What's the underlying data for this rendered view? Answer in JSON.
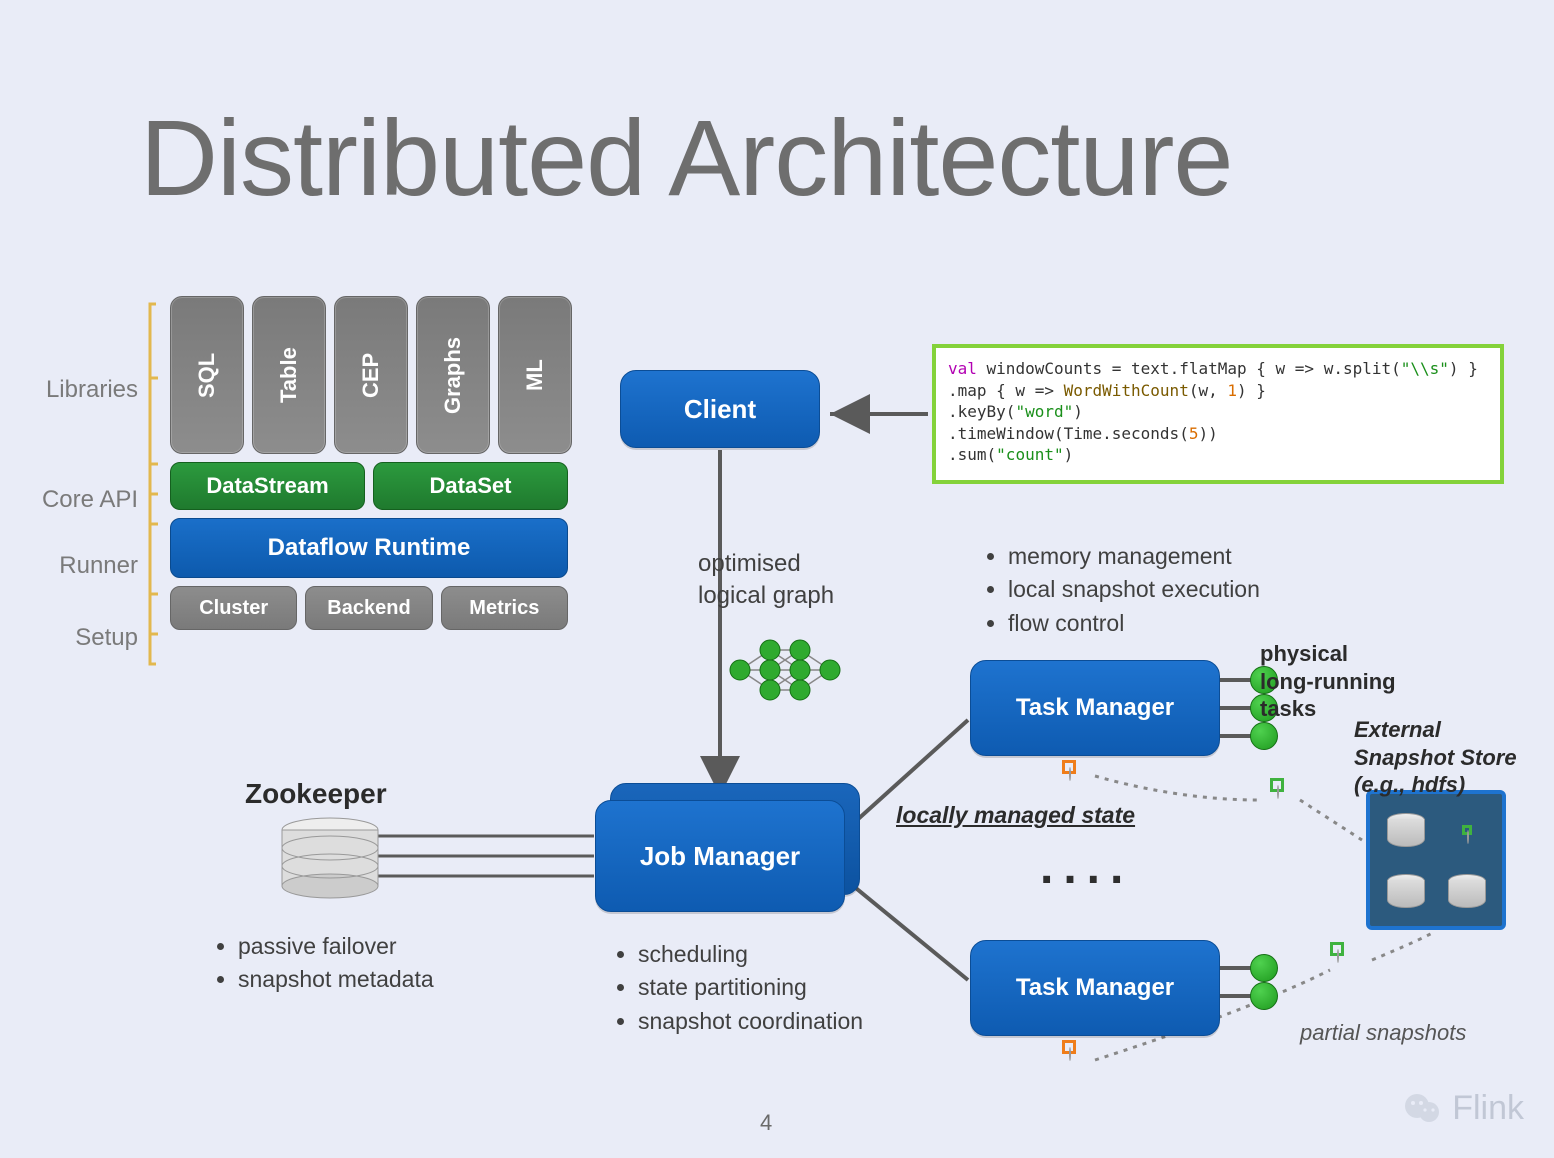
{
  "title": "Distributed Architecture",
  "page_number": "4",
  "watermark": "Flink",
  "stack": {
    "labels": {
      "libraries": "Libraries",
      "core_api": "Core API",
      "runner": "Runner",
      "setup": "Setup"
    },
    "libraries": [
      "SQL",
      "Table",
      "CEP",
      "Graphs",
      "ML"
    ],
    "core_api": [
      "DataStream",
      "DataSet"
    ],
    "runner": "Dataflow Runtime",
    "setup": [
      "Cluster",
      "Backend",
      "Metrics"
    ]
  },
  "nodes": {
    "client": "Client",
    "job_manager": "Job Manager",
    "task_manager": "Task Manager"
  },
  "labels": {
    "zookeeper": "Zookeeper",
    "optimised_graph_l1": "optimised",
    "optimised_graph_l2": "logical graph",
    "locally_managed_state": "locally managed state",
    "physical_tasks_l1": "physical",
    "physical_tasks_l2": "long-running",
    "physical_tasks_l3": "tasks",
    "external_store_l1": "External",
    "external_store_l2": "Snapshot Store",
    "external_store_l3": "(e.g., hdfs)",
    "partial_snapshots": "partial snapshots"
  },
  "bullets": {
    "zookeeper": [
      "passive failover",
      "snapshot metadata"
    ],
    "job_manager": [
      "scheduling",
      "state partitioning",
      "snapshot coordination"
    ],
    "task_manager": [
      "memory management",
      "local snapshot execution",
      "flow control"
    ]
  },
  "code": {
    "line1_a": "val",
    "line1_b": " windowCounts = text.flatMap { w => w.split(",
    "line1_c": "\"\\\\s\"",
    "line1_d": ") }",
    "line2_a": "  .map { w => ",
    "line2_b": "WordWithCount",
    "line2_c": "(w, ",
    "line2_d": "1",
    "line2_e": ") }",
    "line3_a": "  .keyBy(",
    "line3_b": "\"word\"",
    "line3_c": ")",
    "line4_a": "  .timeWindow(Time.seconds(",
    "line4_b": "5",
    "line4_c": "))",
    "line5_a": "  .sum(",
    "line5_b": "\"count\"",
    "line5_c": ")"
  },
  "chart_data": {
    "type": "diagram",
    "title": "Distributed Architecture",
    "layers": [
      {
        "name": "Libraries",
        "items": [
          "SQL",
          "Table",
          "CEP",
          "Graphs",
          "ML"
        ]
      },
      {
        "name": "Core API",
        "items": [
          "DataStream",
          "DataSet"
        ]
      },
      {
        "name": "Runner",
        "items": [
          "Dataflow Runtime"
        ]
      },
      {
        "name": "Setup",
        "items": [
          "Cluster",
          "Backend",
          "Metrics"
        ]
      }
    ],
    "flow": [
      {
        "from": "code",
        "to": "Client"
      },
      {
        "from": "Client",
        "to": "Job Manager",
        "label": "optimised logical graph"
      },
      {
        "from": "Zookeeper",
        "to": "Job Manager",
        "notes": [
          "passive failover",
          "snapshot metadata"
        ]
      },
      {
        "from": "Job Manager",
        "to": "Task Manager",
        "multiplicity": "many",
        "jm_notes": [
          "scheduling",
          "state partitioning",
          "snapshot coordination"
        ]
      },
      {
        "from": "Task Manager",
        "to": "physical long-running tasks",
        "tm_notes": [
          "memory management",
          "local snapshot execution",
          "flow control"
        ]
      },
      {
        "from": "Task Manager",
        "to": "External Snapshot Store (e.g., hdfs)",
        "via": "partial snapshots",
        "state": "locally managed state"
      }
    ]
  }
}
